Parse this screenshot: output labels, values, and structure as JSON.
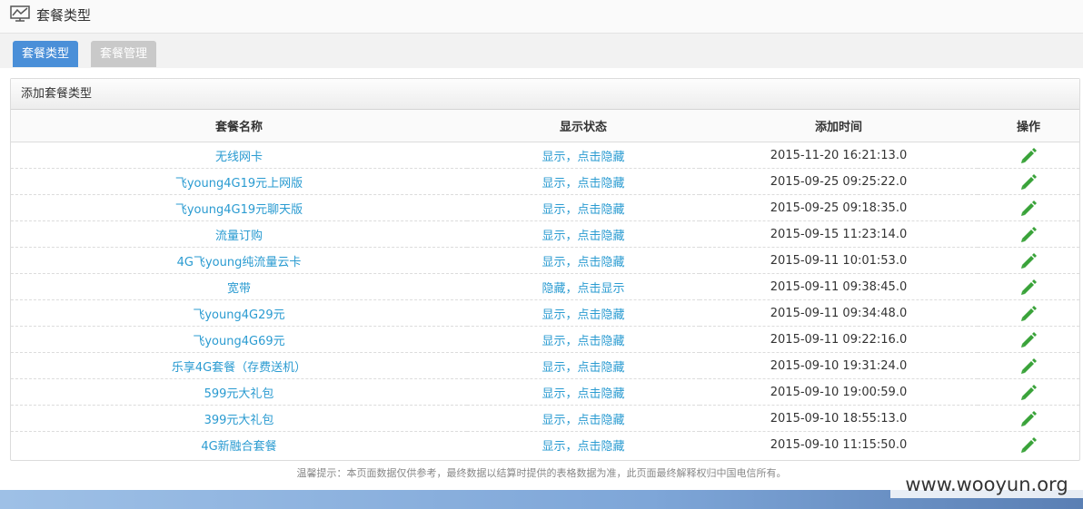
{
  "header": {
    "title": "套餐类型"
  },
  "tabs": [
    {
      "label": "套餐类型",
      "active": true
    },
    {
      "label": "套餐管理",
      "active": false
    }
  ],
  "panel": {
    "title": "添加套餐类型"
  },
  "table": {
    "columns": [
      "套餐名称",
      "显示状态",
      "添加时间",
      "操作"
    ],
    "rows": [
      {
        "name": "无线网卡",
        "status": "显示，点击隐藏",
        "time": "2015-11-20 16:21:13.0"
      },
      {
        "name": "飞young4G19元上网版",
        "status": "显示，点击隐藏",
        "time": "2015-09-25 09:25:22.0"
      },
      {
        "name": "飞young4G19元聊天版",
        "status": "显示，点击隐藏",
        "time": "2015-09-25 09:18:35.0"
      },
      {
        "name": "流量订购",
        "status": "显示，点击隐藏",
        "time": "2015-09-15 11:23:14.0"
      },
      {
        "name": "4G飞young纯流量云卡",
        "status": "显示，点击隐藏",
        "time": "2015-09-11 10:01:53.0"
      },
      {
        "name": "宽带",
        "status": "隐藏，点击显示",
        "time": "2015-09-11 09:38:45.0"
      },
      {
        "name": "飞young4G29元",
        "status": "显示，点击隐藏",
        "time": "2015-09-11 09:34:48.0"
      },
      {
        "name": "飞young4G69元",
        "status": "显示，点击隐藏",
        "time": "2015-09-11 09:22:16.0"
      },
      {
        "name": "乐享4G套餐（存费送机）",
        "status": "显示，点击隐藏",
        "time": "2015-09-10 19:31:24.0"
      },
      {
        "name": "599元大礼包",
        "status": "显示，点击隐藏",
        "time": "2015-09-10 19:00:59.0"
      },
      {
        "name": "399元大礼包",
        "status": "显示，点击隐藏",
        "time": "2015-09-10 18:55:13.0"
      },
      {
        "name": "4G新融合套餐",
        "status": "显示，点击隐藏",
        "time": "2015-09-10 11:15:50.0"
      }
    ]
  },
  "footer": {
    "note": "温馨提示：本页面数据仅供参考，最终数据以结算时提供的表格数据为准，此页面最终解释权归中国电信所有。"
  },
  "watermark": "www.wooyun.org",
  "colors": {
    "tab_active": "#4a8fd8",
    "tab_inactive": "#c9c9c9",
    "link": "#2a9bd1",
    "edit_icon": "#3aa33a"
  }
}
